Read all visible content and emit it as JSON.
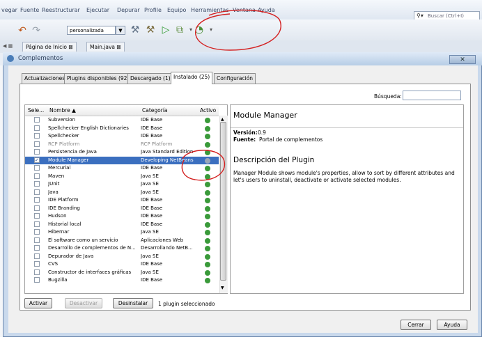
{
  "ide": {
    "menu": [
      "vegar",
      "Fuente",
      "Reestructurar",
      "Ejecutar",
      "Depurar",
      "Profile",
      "Equipo",
      "Herramientas",
      "Ventana",
      "Ayuda"
    ],
    "search_placeholder": "Buscar (Ctrl+I)",
    "config_combo": "personalizada",
    "editor_tabs": [
      "Página de Inicio",
      "Main.java"
    ]
  },
  "dialog": {
    "title": "Complementos",
    "tabs": [
      "Actualizaciones",
      "Plugins disponibles (92)",
      "Descargado (1)",
      "Instalado (25)",
      "Configuración"
    ],
    "selected_tab": "Instalado (25)",
    "search_label": "Búsqueda:",
    "table": {
      "headers": [
        "Sele...",
        "Nombre ▲",
        "Categoría",
        "Activo"
      ],
      "rows": [
        {
          "name": "Subversion",
          "category": "IDE Base"
        },
        {
          "name": "Spellchecker English Dictionaries",
          "category": "IDE Base"
        },
        {
          "name": "Spellchecker",
          "category": "IDE Base"
        },
        {
          "name": "RCP Platform",
          "category": "RCP Platform"
        },
        {
          "name": "Persistencia de Java",
          "category": "Java Standard Edition"
        },
        {
          "name": "Module Manager",
          "category": "Developing NetBeans"
        },
        {
          "name": "Mercurial",
          "category": "IDE Base"
        },
        {
          "name": "Maven",
          "category": "Java SE"
        },
        {
          "name": "JUnit",
          "category": "Java SE"
        },
        {
          "name": "Java",
          "category": "Java SE"
        },
        {
          "name": "IDE Platform",
          "category": "IDE Base"
        },
        {
          "name": "IDE Branding",
          "category": "IDE Base"
        },
        {
          "name": "Hudson",
          "category": "IDE Base"
        },
        {
          "name": "Historial local",
          "category": "IDE Base"
        },
        {
          "name": "Hibernar",
          "category": "Java SE"
        },
        {
          "name": "El software como un servicio",
          "category": "Aplicaciones Web"
        },
        {
          "name": "Desarrollo de complementos de N...",
          "category": "Desarrollando NetB..."
        },
        {
          "name": "Depurador de Java",
          "category": "Java SE"
        },
        {
          "name": "CVS",
          "category": "IDE Base"
        },
        {
          "name": "Constructor de interfaces gráficas",
          "category": "Java SE"
        },
        {
          "name": "Bugzilla",
          "category": "IDE Base"
        }
      ]
    },
    "detail": {
      "title": "Module Manager",
      "version_label": "Versión:",
      "version_value": "0.9",
      "source_label": "Fuente:",
      "source_value": "Portal de complementos",
      "desc_title": "Descripción del Plugin",
      "desc_text": "Manager Module shows module's properties, allow to sort by different attributes and let's users to uninstall, deactivate or activate selected modules."
    },
    "buttons": {
      "activar": "Activar",
      "desactivar": "Desactivar",
      "desinstalar": "Desinstalar",
      "status": "1 plugin seleccionado",
      "cerrar": "Cerrar",
      "ayuda": "Ayuda"
    }
  },
  "colors": {
    "selection": "#3b6fbf",
    "active_ok": "#3a9a3a",
    "annotation": "#d42020"
  }
}
